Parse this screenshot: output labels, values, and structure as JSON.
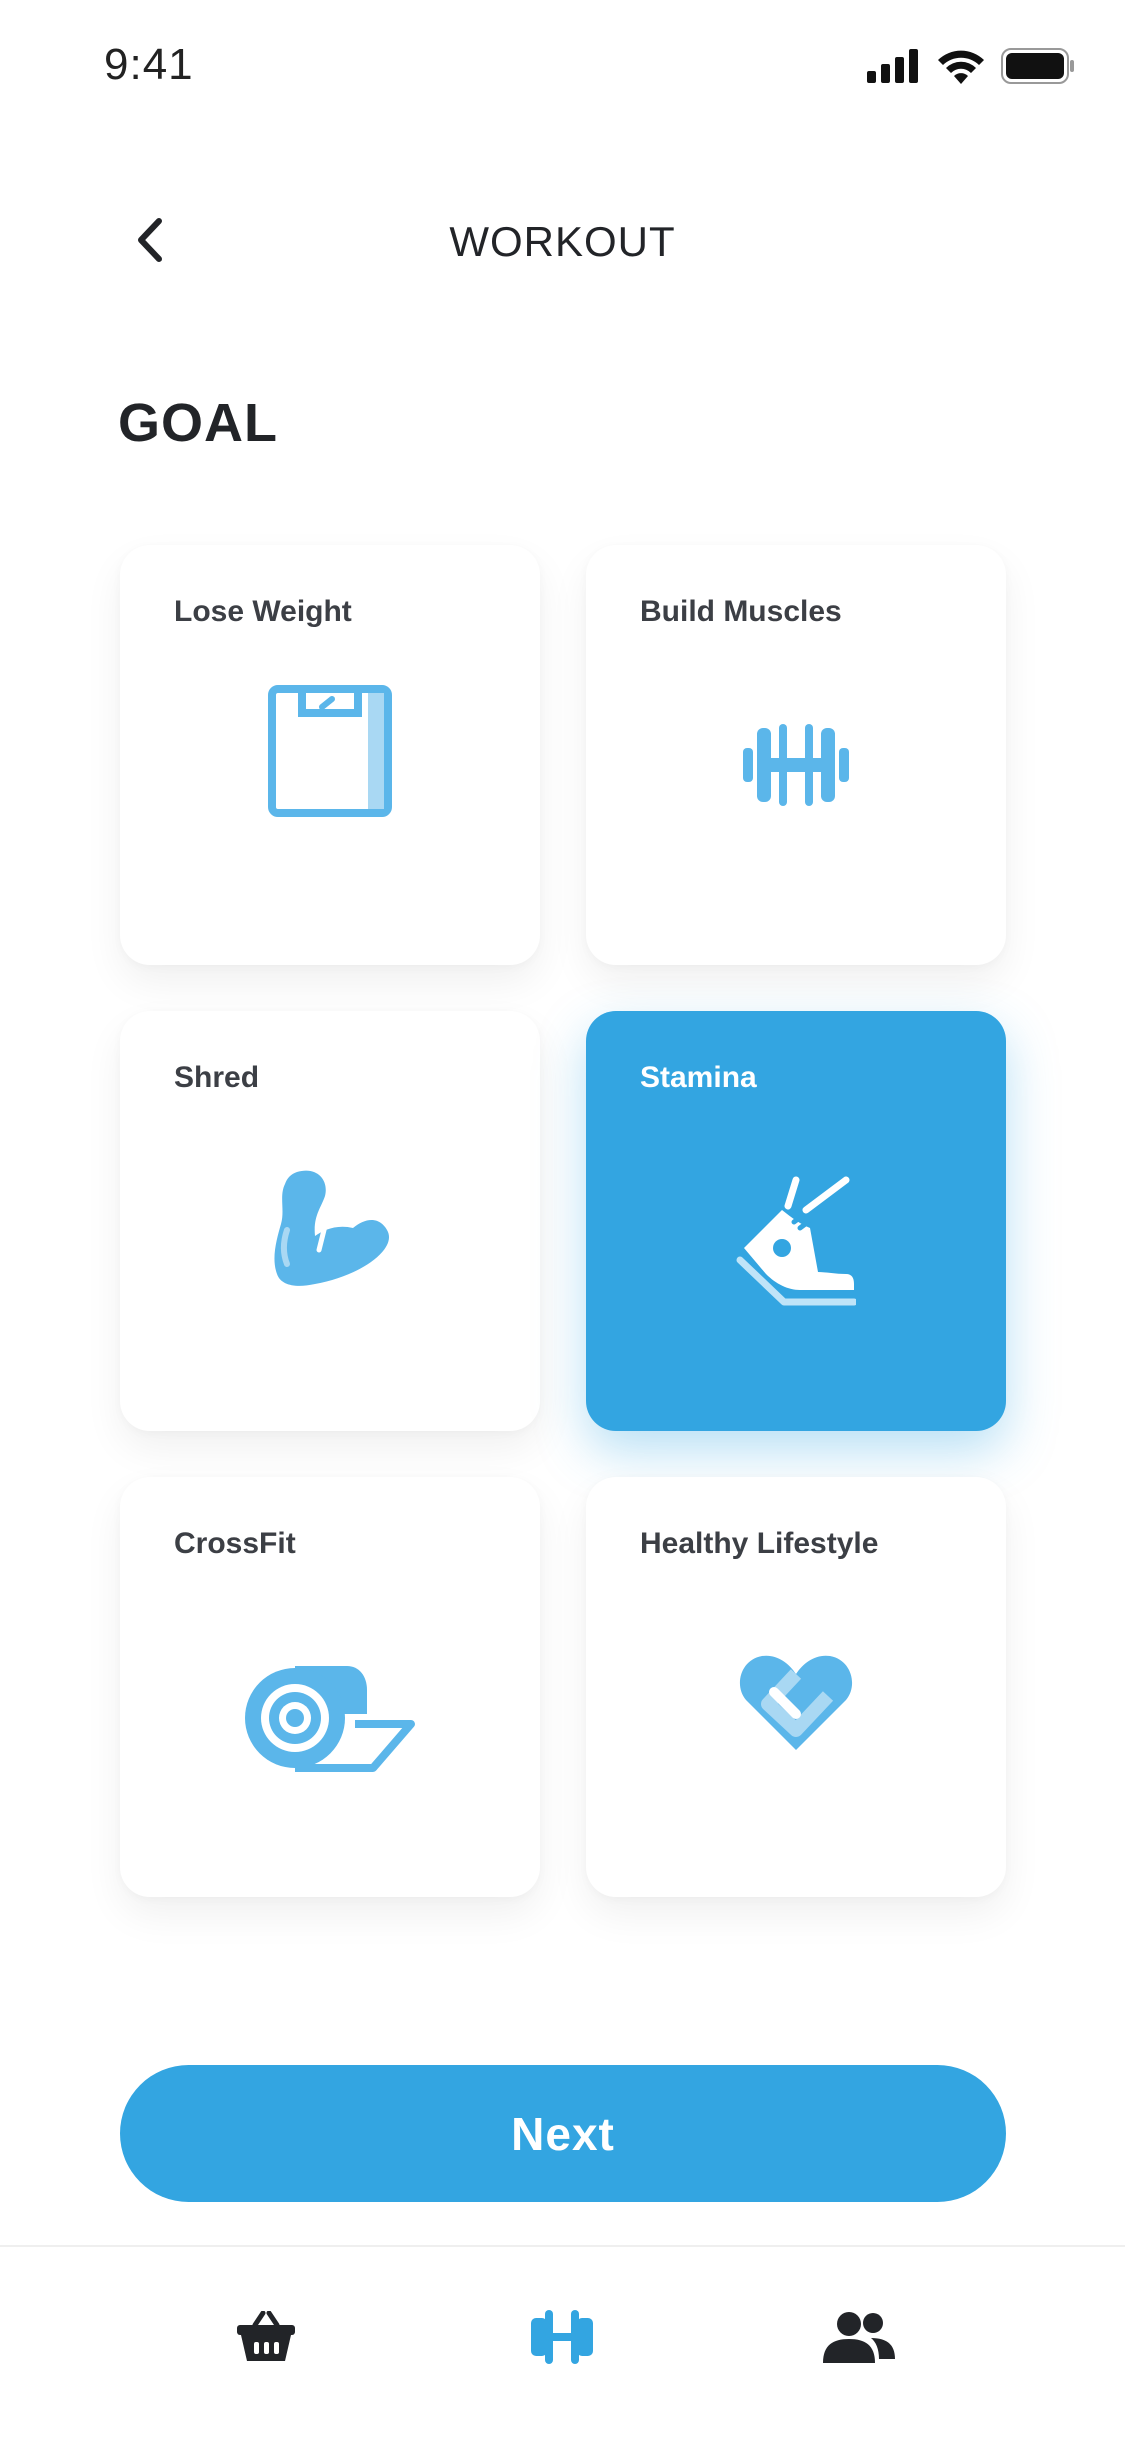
{
  "status_bar": {
    "time": "9:41",
    "icons": [
      "signal-icon",
      "wifi-icon",
      "battery-icon"
    ]
  },
  "header": {
    "title": "WORKOUT",
    "back_icon": "chevron-left-icon"
  },
  "section": {
    "title": "GOAL"
  },
  "goals": [
    {
      "label": "Lose Weight",
      "icon": "scale-icon",
      "selected": false
    },
    {
      "label": "Build Muscles",
      "icon": "dumbbell-icon",
      "selected": false
    },
    {
      "label": "Shred",
      "icon": "flexed-arm-icon",
      "selected": false
    },
    {
      "label": "Stamina",
      "icon": "running-shoe-icon",
      "selected": true
    },
    {
      "label": "CrossFit",
      "icon": "yoga-mat-icon",
      "selected": false
    },
    {
      "label": "Healthy Lifestyle",
      "icon": "heart-icon",
      "selected": false
    }
  ],
  "next_button": {
    "label": "Next"
  },
  "tab_bar": {
    "tabs": [
      {
        "icon": "shop-basket-icon",
        "active": false
      },
      {
        "icon": "dumbbell-icon",
        "active": true
      },
      {
        "icon": "community-icon",
        "active": false
      }
    ]
  },
  "colors": {
    "accent": "#33a5e1",
    "icon_blue": "#5bb6ea",
    "text_dark": "#222428",
    "card_label": "#3c3f45"
  }
}
